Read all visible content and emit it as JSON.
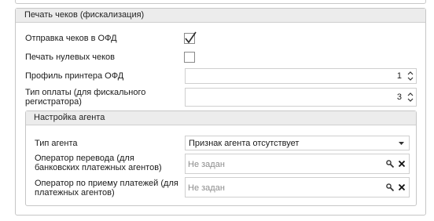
{
  "fiscal_section": {
    "title": "Печать чеков (фискализация)",
    "send_to_ofd": {
      "label": "Отправка чеков в ОФД",
      "checked": true
    },
    "print_zero": {
      "label": "Печать нулевых чеков",
      "checked": false
    },
    "printer_profile": {
      "label": "Профиль принтера ОФД",
      "value": "1"
    },
    "payment_type": {
      "label": "Тип оплаты (для фискального регистратора)",
      "value": "3"
    }
  },
  "agent_section": {
    "title": "Настройка агента",
    "agent_type": {
      "label": "Тип агента",
      "value": "Признак агента отсутствует"
    },
    "transfer_operator": {
      "label": "Оператор перевода (для банковских платежных агентов)",
      "placeholder": "Не задан"
    },
    "payment_operator": {
      "label": "Оператор по приему платежей (для платежных агентов)",
      "placeholder": "Не задан"
    }
  },
  "icons": {
    "check": "checkmark-icon",
    "spin": "spin-arrows-icon",
    "dropdown": "chevron-down-icon",
    "search": "search-icon",
    "clear": "close-icon"
  },
  "colors": {
    "border": "#c6c6c6",
    "header_bg": "#ececec",
    "placeholder": "#8c8c8c"
  }
}
